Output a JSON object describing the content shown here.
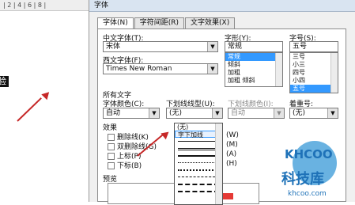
{
  "document": {
    "ruler_text": "| 2 | 4 | 6 | 8 |",
    "selected_text": "验"
  },
  "dialog": {
    "title": "字体",
    "tabs": [
      "字体(N)",
      "字符间距(R)",
      "文字效果(X)"
    ],
    "chinese_font_label": "中文字体(T):",
    "chinese_font_value": "宋体",
    "western_font_label": "西文字体(F):",
    "western_font_value": "Times New Roman",
    "style_label": "字形(Y):",
    "style_value": "常规",
    "style_options": [
      "常规",
      "倾斜",
      "加粗",
      "加粗 倾斜"
    ],
    "size_label": "字号(S):",
    "size_value": "五号",
    "size_options": [
      "三号",
      "小三",
      "四号",
      "小四",
      "五号"
    ],
    "all_text_label": "所有文字",
    "font_color_label": "字体颜色(C):",
    "font_color_value": "自动",
    "underline_label": "下划线线型(U):",
    "underline_value": "(无)",
    "underline_color_label": "下划线颜色(I):",
    "underline_color_value": "自动",
    "emphasis_label": "着重号:",
    "emphasis_value": "(无)",
    "effects_label": "效果",
    "effects": [
      "删除线(K)",
      "双删除线(G)",
      "上标(P)",
      "下标(B)"
    ],
    "effects_right": [
      "(W)",
      "(M)",
      "(A)",
      "(H)"
    ],
    "dropdown_items": [
      "(无)",
      "字下加线"
    ],
    "preview_label": "预览"
  },
  "watermark": {
    "logo_text": "KHCOO",
    "logo_cn": "科技库",
    "logo_url": "khcoo.com"
  }
}
